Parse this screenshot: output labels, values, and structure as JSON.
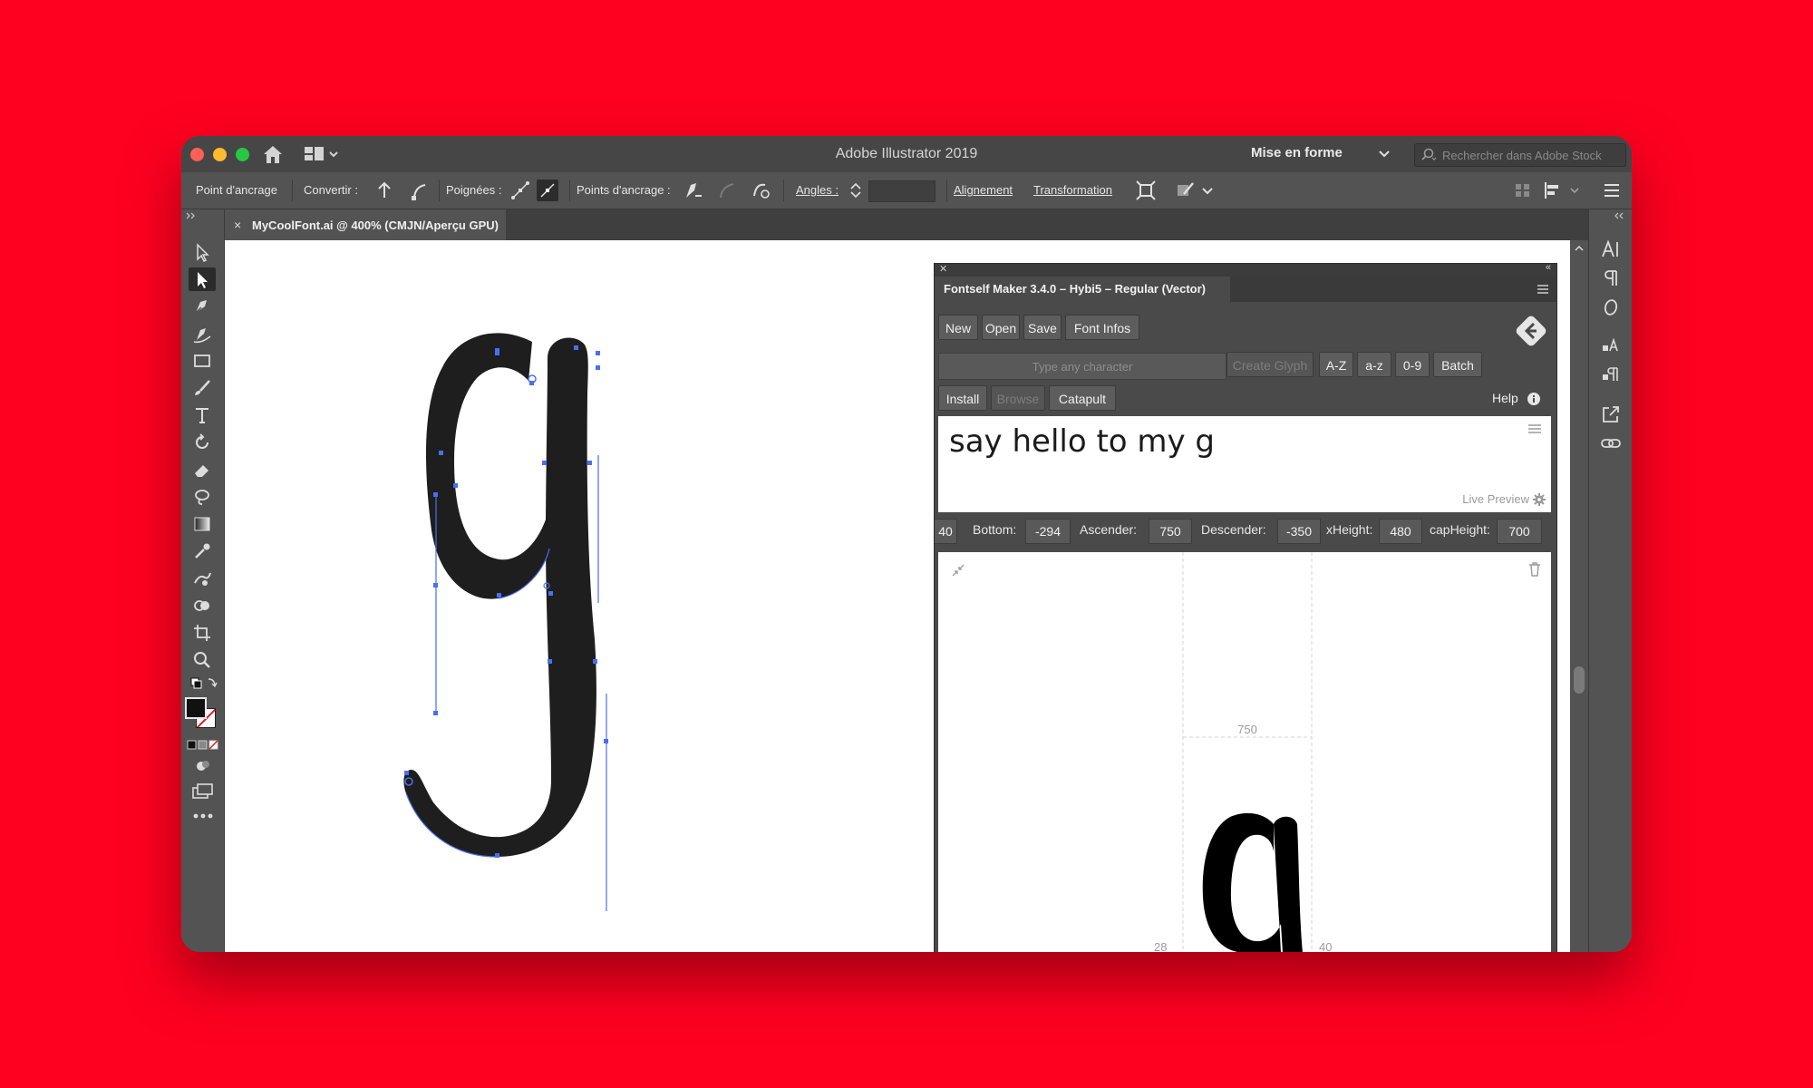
{
  "app": {
    "title": "Adobe Illustrator 2019",
    "workspace": "Mise en forme",
    "search_placeholder": "Rechercher dans Adobe Stock"
  },
  "control_bar": {
    "anchor_point": "Point d'ancrage",
    "convert": "Convertir :",
    "handles": "Poignées :",
    "anchor_points": "Points d'ancrage :",
    "corners": "Angles :",
    "align": "Alignement",
    "transform": "Transformation"
  },
  "document_tab": {
    "close": "×",
    "title": "MyCoolFont.ai @ 400% (CMJN/Aperçu GPU)"
  },
  "fontself": {
    "panel_title": "Fontself Maker 3.4.0 – Hybi5 – Regular (Vector)",
    "buttons": {
      "new": "New",
      "open": "Open",
      "save": "Save",
      "font_infos": "Font Infos",
      "create_glyph": "Create Glyph",
      "upper": "A-Z",
      "lower": "a-z",
      "digits": "0-9",
      "batch": "Batch",
      "install": "Install",
      "browse": "Browse",
      "catapult": "Catapult",
      "help": "Help"
    },
    "char_placeholder": "Type any character",
    "preview_text": "say hello to my g",
    "live_preview": "Live Preview",
    "metrics": {
      "first_value": "40",
      "bottom_label": "Bottom:",
      "bottom": "-294",
      "ascender_label": "Ascender:",
      "ascender": "750",
      "descender_label": "Descender:",
      "descender": "-350",
      "xheight_label": "xHeight:",
      "xheight": "480",
      "capheight_label": "capHeight:",
      "capheight": "700"
    },
    "editor": {
      "ascender_guide": "750",
      "left_bearing": "28",
      "right_bearing": "40"
    }
  },
  "colors": {
    "background": "#fe0020",
    "window": "#535353",
    "selection": "#4a6ff0",
    "glyph": "#1e1e1e"
  }
}
